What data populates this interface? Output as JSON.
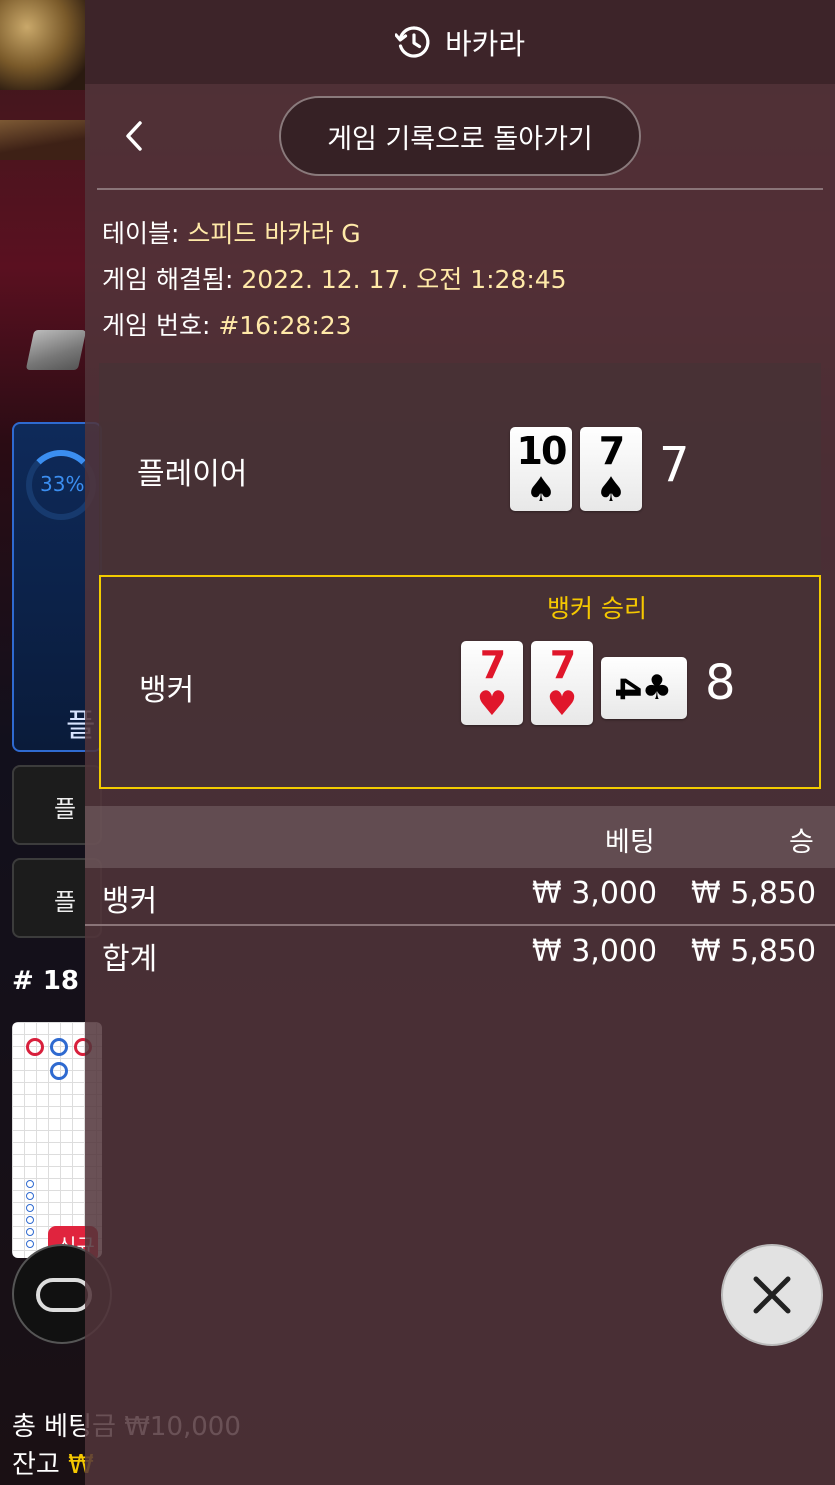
{
  "header": {
    "title": "바카라",
    "history_icon": "history-icon"
  },
  "back": {
    "label": "게임 기록으로 돌아가기",
    "icon": "chevron-left-icon"
  },
  "info": {
    "table_label": "테이블:",
    "table_value": "스피드 바카라 G",
    "resolved_label": "게임 해결됨:",
    "resolved_value": "2022. 12. 17. 오전 1:28:45",
    "number_label": "게임 번호:",
    "number_value": "#16:28:23"
  },
  "player": {
    "label": "플레이어",
    "total": "7",
    "cards": [
      {
        "rank": "10",
        "suit": "♠",
        "color": "black"
      },
      {
        "rank": "7",
        "suit": "♠",
        "color": "black"
      }
    ]
  },
  "banker": {
    "label": "뱅커",
    "win_label": "뱅커 승리",
    "total": "8",
    "cards": [
      {
        "rank": "7",
        "suit": "♥",
        "color": "red"
      },
      {
        "rank": "7",
        "suit": "♥",
        "color": "red"
      },
      {
        "rank": "4",
        "suit": "♣",
        "color": "black",
        "orientation": "sideways"
      }
    ]
  },
  "bets": {
    "headers": {
      "bet": "베팅",
      "win": "승"
    },
    "rows": [
      {
        "name": "뱅커",
        "bet": "₩ 3,000",
        "win": "₩ 5,850"
      },
      {
        "name": "합계",
        "bet": "₩ 3,000",
        "win": "₩ 5,850"
      }
    ]
  },
  "close_icon": "close-icon",
  "background": {
    "progress_percent": "33%",
    "progress_fraction": 0.33,
    "blue_panel_text": "플",
    "button1_text": "플",
    "button2_text": "플",
    "round_count": "# 18",
    "new_badge": "신규",
    "total_bet": "총 베팅금 ₩10,000",
    "balance_label": "잔고",
    "balance_symbol": "₩"
  },
  "colors": {
    "accent_gold": "#f5c800",
    "info_value": "#ffe9a8",
    "red_suit": "#e0162b",
    "banker_border": "#f2cc00"
  }
}
